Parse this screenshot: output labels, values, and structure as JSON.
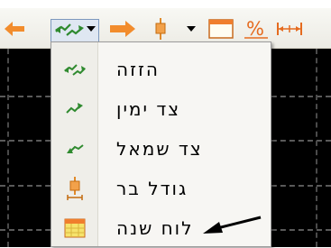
{
  "toolbar": {
    "buttons": [
      {
        "name": "back-arrow-icon"
      },
      {
        "name": "shift-icon",
        "selected": true
      },
      {
        "name": "dropdown-arrow-icon"
      },
      {
        "name": "forward-arrow-icon"
      },
      {
        "name": "bar-size-icon"
      },
      {
        "name": "dropdown-arrow-icon"
      },
      {
        "name": "calendar-window-icon"
      },
      {
        "name": "percent-icon"
      },
      {
        "name": "width-icon"
      }
    ]
  },
  "menu": {
    "items": [
      {
        "label": "הזזה",
        "icon": "shift-both-icon"
      },
      {
        "label": "צד ימין",
        "icon": "right-side-icon"
      },
      {
        "label": "צד שמאל",
        "icon": "left-side-icon"
      },
      {
        "label": "גודל בר",
        "icon": "bar-size-icon"
      },
      {
        "label": "לוח שנה",
        "icon": "year-calendar-icon"
      }
    ]
  },
  "colors": {
    "accent_orange": "#f28c2c",
    "icon_green": "#2f8a2f",
    "chart_background": "#000000",
    "menu_background": "#f7f6f3"
  }
}
